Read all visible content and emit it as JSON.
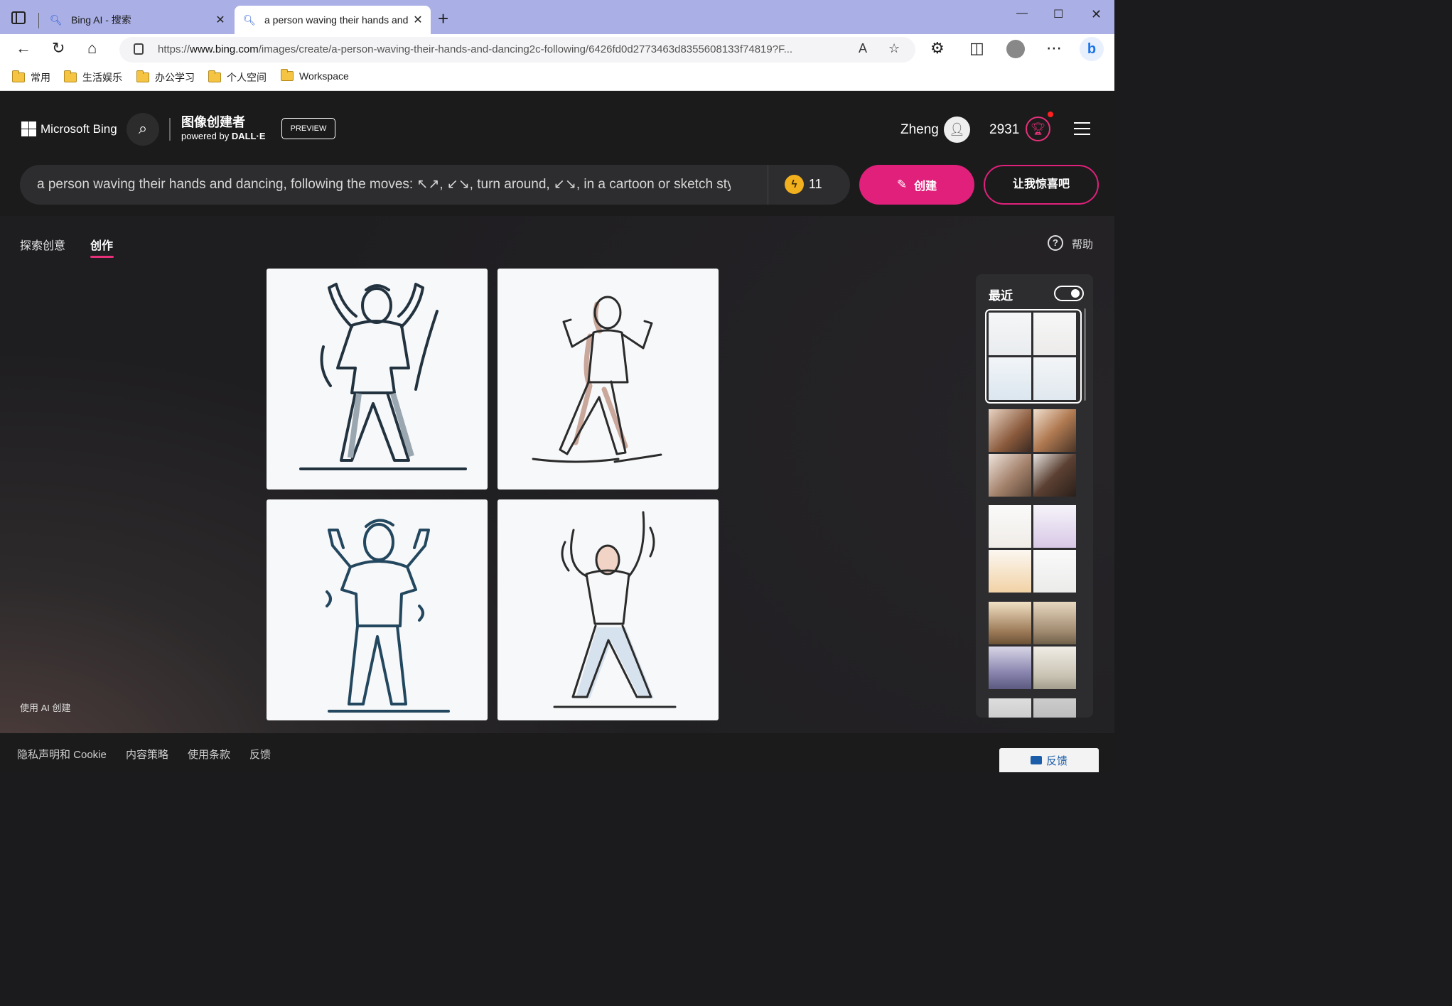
{
  "browser": {
    "tabs": [
      {
        "title": "Bing AI - 搜索",
        "active": false
      },
      {
        "title": "a person waving their hands and d",
        "active": true
      }
    ],
    "url_prefix": "https://",
    "url_domain": "www.bing.com",
    "url_rest": "/images/create/a-person-waving-their-hands-and-dancing2c-following/6426fd0d2773463d8355608133f74819?F...",
    "favorites": [
      "常用",
      "生活娱乐",
      "办公学习",
      "个人空间",
      "Workspace"
    ]
  },
  "header": {
    "logo_text": "Microsoft Bing",
    "product_title": "图像创建者",
    "powered_by": "powered by",
    "powered_brand": "DALL·E",
    "badge": "PREVIEW",
    "user_name": "Zheng",
    "points": "2931"
  },
  "prompt": {
    "text": "a person waving their hands and dancing, following the moves: ↖↗, ↙↘, turn around, ↙↘, in a cartoon or sketch style",
    "boosts": "11",
    "create_label": "创建",
    "surprise_label": "让我惊喜吧"
  },
  "nav": {
    "explore": "探索创意",
    "create": "创作",
    "help": "帮助"
  },
  "results": {
    "images": [
      {
        "alt": "cartoon line sketch of a person dancing with both arms raised"
      },
      {
        "alt": "cartoon sketch of a person walking with hands raised"
      },
      {
        "alt": "cartoon line sketch of a person standing with hands raised"
      },
      {
        "alt": "cartoon sketch of a person dancing with arms up"
      }
    ]
  },
  "recent": {
    "title": "最近",
    "toggle_on": true,
    "groups": [
      {
        "theme": "dancing sketches",
        "selected": true
      },
      {
        "theme": "singing portraits",
        "selected": false
      },
      {
        "theme": "colored dancing sketches",
        "selected": false
      },
      {
        "theme": "dance hall crowd",
        "selected": false
      }
    ]
  },
  "footnote": "使用 AI 创建",
  "footer": {
    "links": [
      "隐私声明和 Cookie",
      "内容策略",
      "使用条款",
      "反馈"
    ],
    "feedback_button": "反馈"
  },
  "colors": {
    "accent": "#e0207b",
    "page_bg": "#1b1b1b"
  }
}
